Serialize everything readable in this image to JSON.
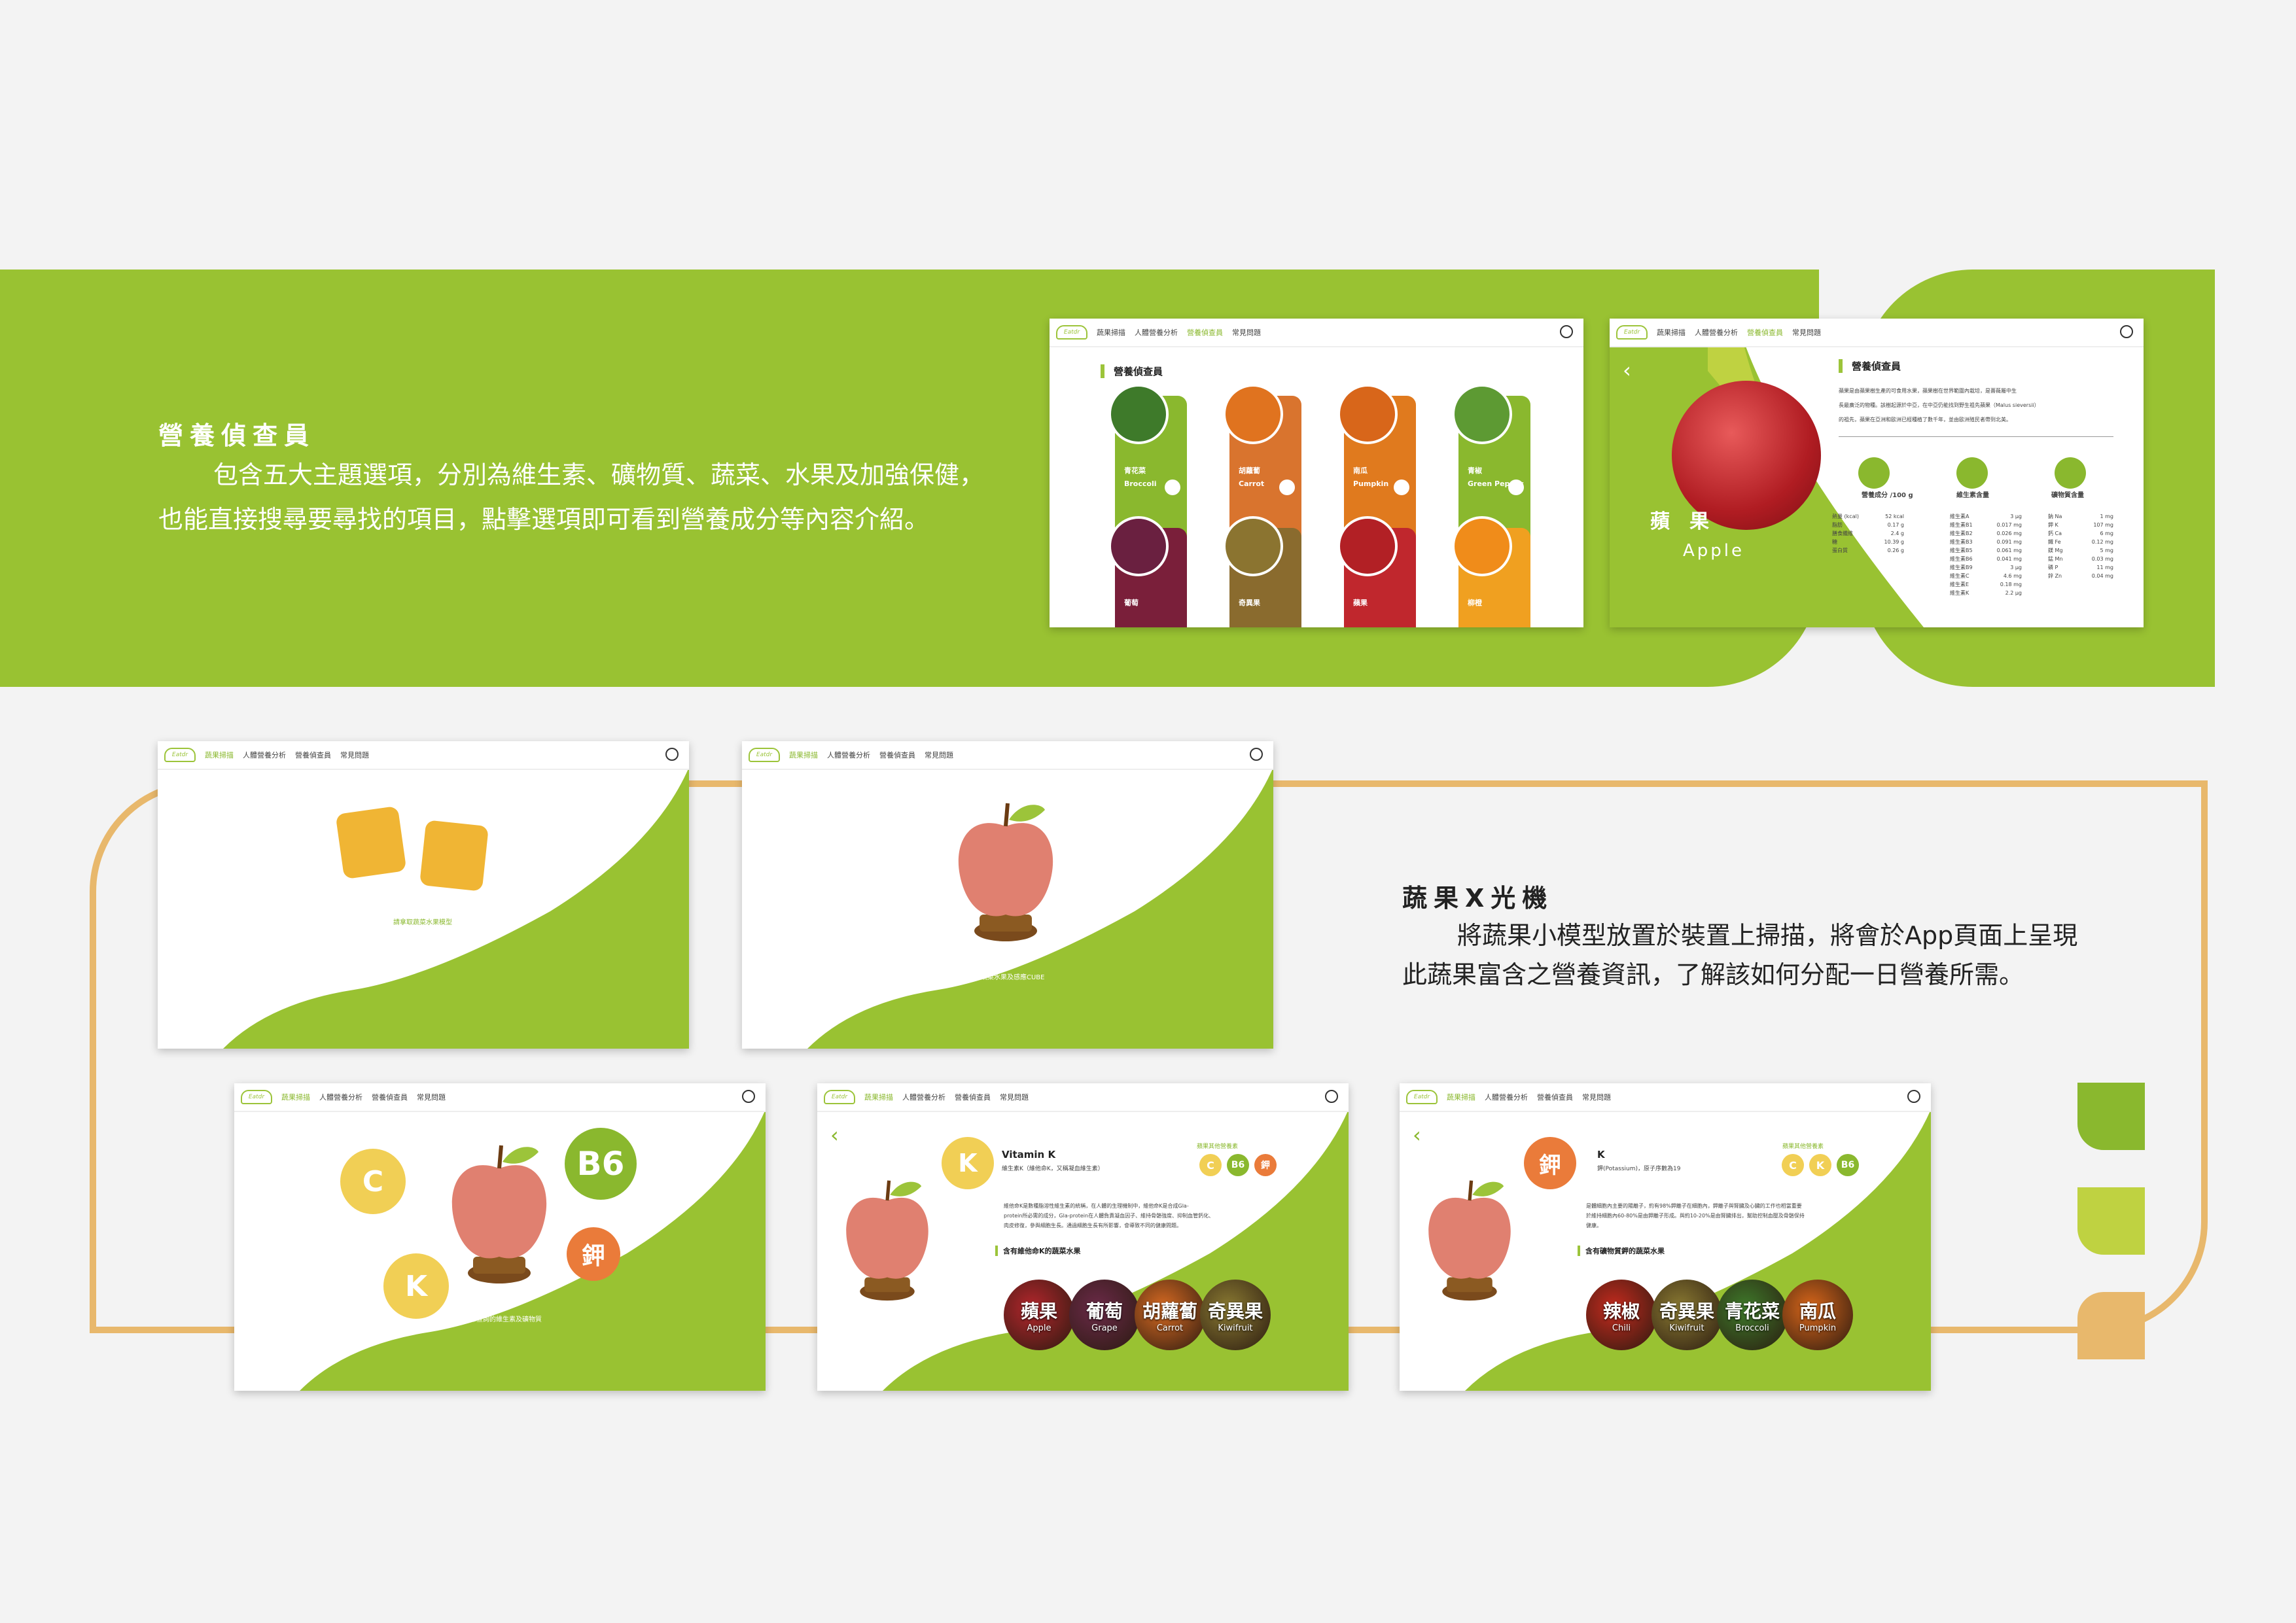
{
  "section1": {
    "title": "營養偵查員",
    "text_line1": "包含五大主題選項，分別為維生素、礦物質、蔬菜、水果及加強保健，",
    "text_line2": "也能直接搜尋要尋找的項目，點擊選項即可看到營養成分等內容介紹。"
  },
  "section2": {
    "title": "蔬果X光機",
    "text_line1": "將蔬果小模型放置於裝置上掃描，將會於App頁面上呈現",
    "text_line2": "此蔬果富含之營養資訊，了解該如何分配一日營養所需。"
  },
  "nav": {
    "logo": "Eatdr",
    "items": [
      "蔬果掃描",
      "人體營養分析",
      "營養偵查員",
      "常見問題"
    ]
  },
  "screen1": {
    "title": "營養偵查員",
    "cards": [
      {
        "zh": "青花菜",
        "en": "Broccoli",
        "color": "#8ab82e",
        "photo": "#3e7a2a"
      },
      {
        "zh": "胡蘿蔔",
        "en": "Carrot",
        "color": "#d9742e",
        "photo": "#e0731f"
      },
      {
        "zh": "南瓜",
        "en": "Pumpkin",
        "color": "#e07a1e",
        "photo": "#d8661a"
      },
      {
        "zh": "青椒",
        "en": "Green Pepper",
        "color": "#8ab82e",
        "photo": "#5d9a33"
      },
      {
        "zh": "葡萄",
        "en": "",
        "color": "#7a1f3a",
        "photo": "#6a2040"
      },
      {
        "zh": "奇異果",
        "en": "",
        "color": "#8a6b2e",
        "photo": "#8b7430"
      },
      {
        "zh": "蘋果",
        "en": "",
        "color": "#c0272d",
        "photo": "#b22025"
      },
      {
        "zh": "柳橙",
        "en": "",
        "color": "#f0a020",
        "photo": "#f08c1a"
      }
    ]
  },
  "screen2": {
    "title": "營養偵查員",
    "fruit_zh": "蘋　果",
    "fruit_en": "Apple",
    "intro_line1": "蘋果是由蘋果樹生產的可食用水果，蘋果樹在世界範圍內栽培，是薔薇屬中生",
    "intro_line2": "長最廣泛的物種。該樹起源於中亞，在中亞仍能找到野生祖先蘋果（Malus sieversii）",
    "intro_line3": "的祖先，蘋果在亞洲和歐洲已經種植了數千年，並由歐洲殖民者帶到北美。",
    "col1_title": "營養成分 /100 g",
    "col2_title": "維生素含量",
    "col3_title": "礦物質含量",
    "nutrients": [
      {
        "name": "熱量 (kcal)",
        "value": "52 kcal"
      },
      {
        "name": "脂肪",
        "value": "0.17 g"
      },
      {
        "name": "膳食纖維",
        "value": "2.4 g"
      },
      {
        "name": "糖",
        "value": "10.39 g"
      },
      {
        "name": "蛋白質",
        "value": "0.26 g"
      }
    ],
    "vitamins": [
      {
        "name": "維生素A",
        "value": "3 μg"
      },
      {
        "name": "維生素B1",
        "value": "0.017 mg"
      },
      {
        "name": "維生素B2",
        "value": "0.026 mg"
      },
      {
        "name": "維生素B3",
        "value": "0.091 mg"
      },
      {
        "name": "維生素B5",
        "value": "0.061 mg"
      },
      {
        "name": "維生素B6",
        "value": "0.041 mg"
      },
      {
        "name": "維生素B9",
        "value": "3 μg"
      },
      {
        "name": "維生素C",
        "value": "4.6 mg"
      },
      {
        "name": "維生素E",
        "value": "0.18 mg"
      },
      {
        "name": "維生素K",
        "value": "2.2 μg"
      }
    ],
    "minerals": [
      {
        "name": "鈉 Na",
        "value": "1 mg"
      },
      {
        "name": "鉀 K",
        "value": "107 mg"
      },
      {
        "name": "鈣 Ca",
        "value": "6 mg"
      },
      {
        "name": "鐵 Fe",
        "value": "0.12 mg"
      },
      {
        "name": "鎂 Mg",
        "value": "5 mg"
      },
      {
        "name": "錳 Mn",
        "value": "0.03 mg"
      },
      {
        "name": "磷 P",
        "value": "11 mg"
      },
      {
        "name": "鋅 Zn",
        "value": "0.04 mg"
      }
    ]
  },
  "screen3": {
    "caption": "請拿取蔬菜水果模型"
  },
  "screen4": {
    "caption": "請拿取蔬菜水果及感應CUBE"
  },
  "screen5": {
    "caption": "點擊想查詢的維生素及礦物質",
    "badges": [
      "C",
      "B6",
      "K",
      "鉀"
    ]
  },
  "screen6": {
    "heading": "Vitamin K",
    "subheading": "維生素K（維他命K，又稱凝血維生素）",
    "badge": "K",
    "other_label": "蘋果其他營養素",
    "others": [
      "C",
      "B6",
      "鉀"
    ],
    "desc_line1": "維他命K是數種脂溶性維生素的統稱，在人體的生理機制中，維他命K是合成Gla-",
    "desc_line2": "protein所必需的成分，Gla-protein在人體負責凝血因子、維持骨骼強度、抑制血管鈣化、",
    "desc_line3": "肉皮修復，參與細胞生長。通過細胞生長有所影響，會導致不同的健康問題。",
    "list_title": "含有維他命K的蔬菜水果",
    "fruits": [
      {
        "zh": "蘋果",
        "en": "Apple",
        "color": "#b3262c"
      },
      {
        "zh": "葡萄",
        "en": "Grape",
        "color": "#6b2a48"
      },
      {
        "zh": "胡蘿蔔",
        "en": "Carrot",
        "color": "#d76a22"
      },
      {
        "zh": "奇異果",
        "en": "Kiwifruit",
        "color": "#8a7a32"
      }
    ]
  },
  "screen7": {
    "heading": "K",
    "subheading": "鉀(Potassium)，原子序數為19",
    "badge": "鉀",
    "other_label": "蘋果其他營養素",
    "others": [
      "C",
      "K",
      "B6"
    ],
    "desc_line1": "是體細胞內主要的陽離子，約有98%鉀離子在細胞內，鉀離子與腎臟及心臟的工作也相當重要",
    "desc_line2": "於維持細胞內60-80%是由鉀離子形成。與約10-20%是由腎臟排出，幫助控制血壓及骨骼保持",
    "desc_line3": "健康。",
    "list_title": "含有礦物質鉀的蔬菜水果",
    "fruits": [
      {
        "zh": "辣椒",
        "en": "Chili",
        "color": "#c42a1e"
      },
      {
        "zh": "奇異果",
        "en": "Kiwifruit",
        "color": "#8a7a32"
      },
      {
        "zh": "青花菜",
        "en": "Broccoli",
        "color": "#3e7a2a"
      },
      {
        "zh": "南瓜",
        "en": "Pumpkin",
        "color": "#d8661a"
      }
    ]
  },
  "colors": {
    "green": "#99c232",
    "lime": "#bfd241",
    "orange": "#e8b86c"
  }
}
